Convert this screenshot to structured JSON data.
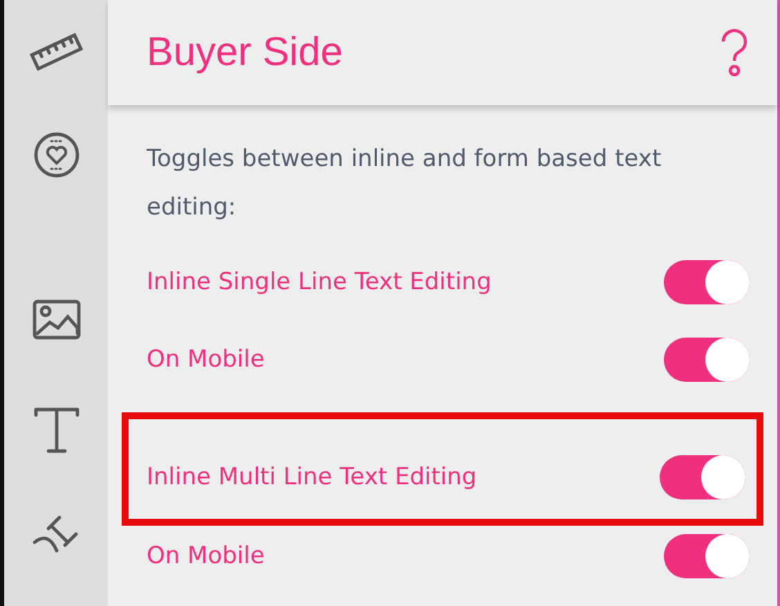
{
  "panel": {
    "title": "Buyer Side",
    "description": "Toggles between inline and form based text editing:"
  },
  "toggles": [
    {
      "label": "Inline Single Line Text Editing",
      "on": true,
      "highlighted": false
    },
    {
      "label": "On Mobile",
      "on": true,
      "highlighted": false
    },
    {
      "label": "Inline Multi Line Text Editing",
      "on": true,
      "highlighted": true
    },
    {
      "label": "On Mobile",
      "on": true,
      "highlighted": false
    }
  ]
}
